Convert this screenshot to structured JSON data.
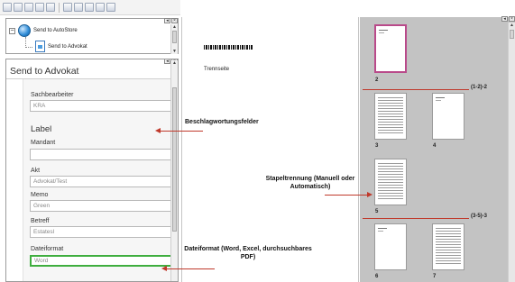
{
  "tree": {
    "root_label": "Send to AutoStore",
    "child_label": "Send to Advokat"
  },
  "form": {
    "title": "Send to Advokat",
    "sachbearbeiter_label": "Sachbearbeiter",
    "sachbearbeiter_value": "KRA",
    "section_label": "Label",
    "mandant_label": "Mandant",
    "mandant_value": "",
    "akt_label": "Akt",
    "akt_value": "Advokat/Test",
    "memo_label": "Memo",
    "memo_value": "Green",
    "betreff_label": "Betreff",
    "betreff_value": "Estatesl",
    "dateiformat_label": "Dateiformat",
    "dateiformat_value": "Word"
  },
  "document": {
    "trennseite": "Trennseite"
  },
  "thumbnails": {
    "page_labels": [
      "2",
      "3",
      "4",
      "5",
      "6",
      "7"
    ],
    "separator_labels": [
      "(1-2)-2",
      "(3-5)-3"
    ]
  },
  "annotations": {
    "fields": "Beschlagwortungsfelder",
    "stack": "Stapeltrennung (Manuell oder Automatisch)",
    "format": "Dateiformat (Word, Excel, durchsuchbares PDF)"
  },
  "colors": {
    "accent_red": "#c0392b",
    "active_field_border": "#3fae3f",
    "selected_thumb_border": "#b94a8a",
    "thumb_pane_bg": "#c3c3c3"
  }
}
